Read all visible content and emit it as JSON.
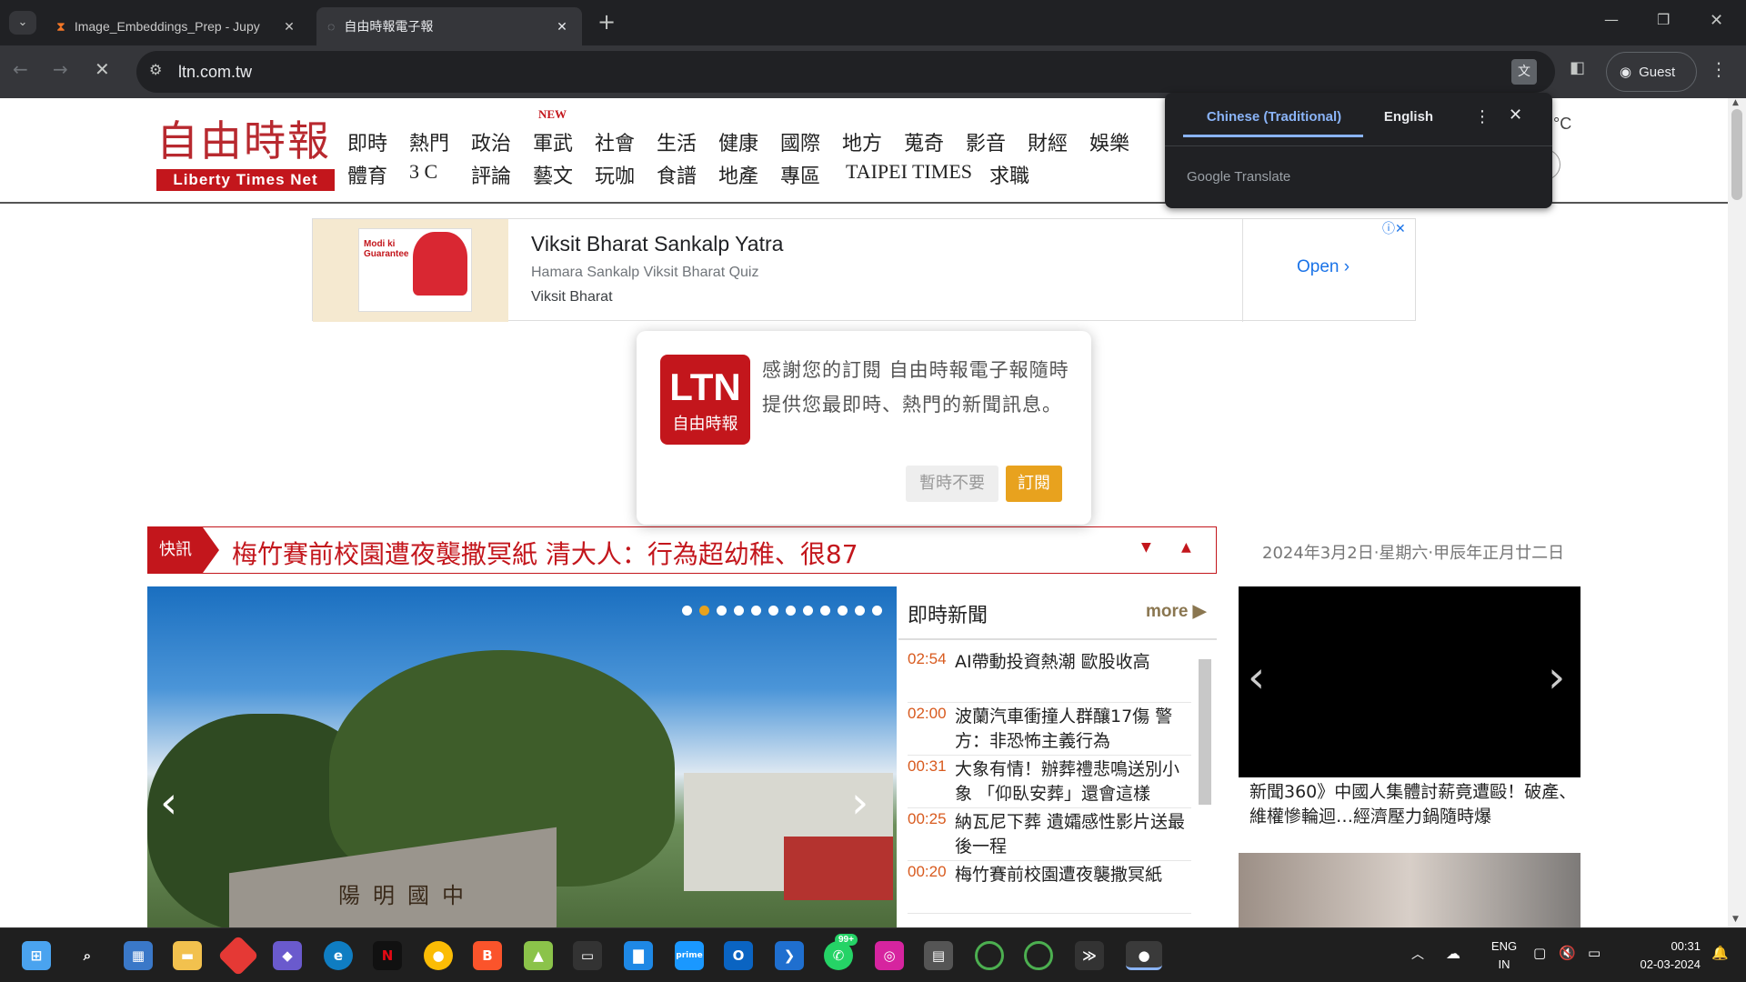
{
  "browser": {
    "tabs": [
      {
        "title": "Image_Embeddings_Prep - Jupy",
        "icon": "hourglass-icon"
      },
      {
        "title": "自由時報電子報",
        "icon": "loading-spinner-icon"
      }
    ],
    "new_tab_label": "+",
    "url": "ltn.com.tw",
    "profile_label": "Guest"
  },
  "translate_popup": {
    "source_lang": "Chinese (Traditional)",
    "target_lang": "English",
    "footer": "Google Translate"
  },
  "site": {
    "logo_text": "自由時報",
    "logo_sub": "Liberty Times Net",
    "new_badge": "NEW",
    "nav_row1": [
      "即時",
      "熱門",
      "政治",
      "軍武",
      "社會",
      "生活",
      "健康",
      "國際",
      "地方",
      "蒐奇",
      "影音",
      "財經",
      "娛樂"
    ],
    "nav_row2": [
      "體育",
      "3 C",
      "評論",
      "藝文",
      "玩咖",
      "食譜",
      "地產",
      "專區",
      "TAIPEI TIMES",
      "求職"
    ],
    "weather_unit": "°C"
  },
  "ad": {
    "title": "Viksit Bharat Sankalp Yatra",
    "subtitle": "Hamara Sankalp Viksit Bharat Quiz",
    "brand": "Viksit Bharat",
    "cta": "Open",
    "image_caption": "Modi ki Guarantee"
  },
  "subscribe_popup": {
    "logo_big": "LTN",
    "logo_small": "自由時報",
    "message": "感謝您的訂閱 自由時報電子報隨時提供您最即時、熱門的新聞訊息。",
    "decline": "暫時不要",
    "accept": "訂閱"
  },
  "breaking": {
    "label": "快訊",
    "headline": "梅竹賽前校園遭夜襲撒冥紙 清大人：行為超幼稚、很87",
    "date": "2024年3月2日‧星期六‧甲辰年正月廿二日"
  },
  "slider": {
    "active_index": 1,
    "dot_count": 12,
    "stone_text": "陽明國中"
  },
  "news": {
    "heading": "即時新聞",
    "more": "more",
    "items": [
      {
        "time": "02:54",
        "title": "AI帶動投資熱潮 歐股收高"
      },
      {
        "time": "02:00",
        "title": "波蘭汽車衝撞人群釀17傷 警方：非恐怖主義行為"
      },
      {
        "time": "00:31",
        "title": "大象有情！辦葬禮悲鳴送別小象 「仰臥安葬」還會這樣"
      },
      {
        "time": "00:25",
        "title": "納瓦尼下葬 遺孀感性影片送最後一程"
      },
      {
        "time": "00:20",
        "title": "梅竹賽前校園遭夜襲撒冥紙"
      }
    ]
  },
  "video": {
    "caption": "新聞360》中國人集體討薪竟遭毆！破產、維權慘輪迴…經濟壓力鍋隨時爆"
  },
  "taskbar": {
    "lang_line1": "ENG",
    "lang_line2": "IN",
    "time": "00:31",
    "date": "02-03-2024",
    "whatsapp_badge": "99+"
  }
}
